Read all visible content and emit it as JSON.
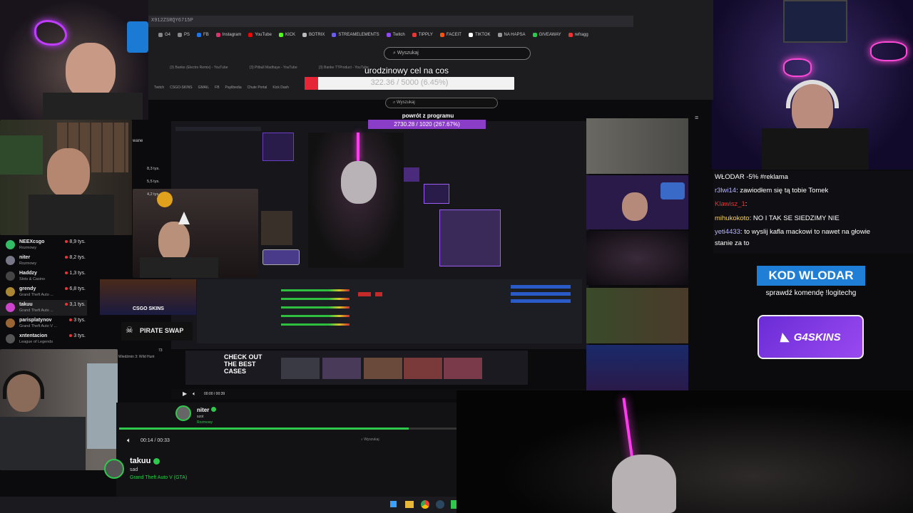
{
  "browser": {
    "url_fragment": "X912ZSRQY6715P",
    "bookmarks": [
      {
        "label": "G4",
        "color": "#888"
      },
      {
        "label": "PS",
        "color": "#888"
      },
      {
        "label": "FB",
        "color": "#1877f2"
      },
      {
        "label": "Instagram",
        "color": "#e1306c"
      },
      {
        "label": "YouTube",
        "color": "#ff0000"
      },
      {
        "label": "KICK",
        "color": "#53fc18"
      },
      {
        "label": "BOTRIX",
        "color": "#bbb"
      },
      {
        "label": "STREAMELEMENTS",
        "color": "#6a5cff"
      },
      {
        "label": "Twitch",
        "color": "#9146ff"
      },
      {
        "label": "TIPPLY",
        "color": "#e33"
      },
      {
        "label": "FACEIT",
        "color": "#ff5500"
      },
      {
        "label": "TIKTOK",
        "color": "#fff"
      },
      {
        "label": "NA HAPSA",
        "color": "#999"
      },
      {
        "label": "GIVEAWAY",
        "color": "#2ec94c"
      },
      {
        "label": "refragg",
        "color": "#e33"
      }
    ],
    "search_placeholder": "Wyszukaj",
    "inner_tabs": [
      "(3) Banke (Electro Remix) - YouTube",
      "(3) Pitbull Madhaye - YouTube",
      "(3) Banke TTProduct - YouTube"
    ],
    "inner_bookmarks": [
      "Twitch",
      "CSGO-SKINS",
      "GMAIL",
      "FB",
      "Paylibedia",
      "Chute Portal",
      "Kick Dash"
    ],
    "inner_search_placeholder": "Wyszukaj"
  },
  "goal": {
    "title": "urodzinowy cel na cos",
    "text": "322.36 / 5000 (6.45%)",
    "progress": 0.0645
  },
  "return_goal": {
    "title": "powrót z programu",
    "text": "2730.28 / 1020 (267.67%)"
  },
  "chat": {
    "messages": [
      {
        "user": "WŁODAR",
        "user_color": "#ffffff",
        "text": " -5% #reklama"
      },
      {
        "user": "r3lwi14",
        "user_color": "#b7b7ff",
        "text": ": zawiodłem się tą tobie Tomek"
      },
      {
        "user": "Klawisz_1",
        "user_color": "#e03535",
        "text": ":"
      },
      {
        "user": "mihukokoto",
        "user_color": "#ffd34d",
        "text": ": NO I TAK SE SIEDZIMY NIE"
      },
      {
        "user": "yeti4433",
        "user_color": "#b7b7ff",
        "text": ": to wyslij kafla mackowi to nawet na głowie"
      },
      {
        "user": "",
        "user_color": "#ffffff",
        "text": "stanie za to"
      }
    ]
  },
  "promo": {
    "kod": "KOD WLODAR",
    "sub": "sprawdź komendę !logitechg",
    "brand": "G4SKINS"
  },
  "follow_list": [
    {
      "name": "NEEXcsgo",
      "game": "Rozmowy",
      "count": "8,9 tys.",
      "avatar": "#3b6"
    },
    {
      "name": "niter",
      "game": "Rozmowy",
      "count": "8,2 tys.",
      "avatar": "#778"
    },
    {
      "name": "Haddzy",
      "game": "Slots & Casino",
      "count": "1,3 tys.",
      "avatar": "#444"
    },
    {
      "name": "grendy",
      "game": "Grand Theft Auto ...",
      "count": "6,8 tys.",
      "avatar": "#a83"
    },
    {
      "name": "takuu",
      "game": "Grand Theft Auto ...",
      "count": "3,1 tys.",
      "avatar": "#c4c"
    },
    {
      "name": "parisplatynov",
      "game": "Grand Theft Auto V ...",
      "count": "3 tys.",
      "avatar": "#963"
    },
    {
      "name": "xntentacion",
      "game": "League of Legends",
      "count": "3 tys.",
      "avatar": "#555"
    }
  ],
  "side_counts": [
    "8,3 tys.",
    "5,5 tys.",
    "4,2 tys."
  ],
  "side_words": [
    "wane"
  ],
  "pirate": "PIRATE SWAP",
  "csgo_skins": "CSGO SKINS",
  "check_out": "CHECK OUT THE BEST CASES",
  "mini_player_time": "00:00 / 00:39",
  "player": {
    "top_name": "niter",
    "top_sub": "szot",
    "top_game": "Rozmowy",
    "time": "00:14 / 00:33",
    "search_placeholder": "Wyszukaj",
    "name": "takuu",
    "sub": "sad",
    "game": "Grand Theft Auto V (GTA)",
    "progress": 0.857
  },
  "frame_label": "Wiedźmin 3: Wild Hunt",
  "badge": "73",
  "colors": {
    "accent": "#8a3ec7",
    "live": "#2ec94c",
    "goal_fill": "#e62636",
    "kod_bg": "#1f7fd6"
  }
}
